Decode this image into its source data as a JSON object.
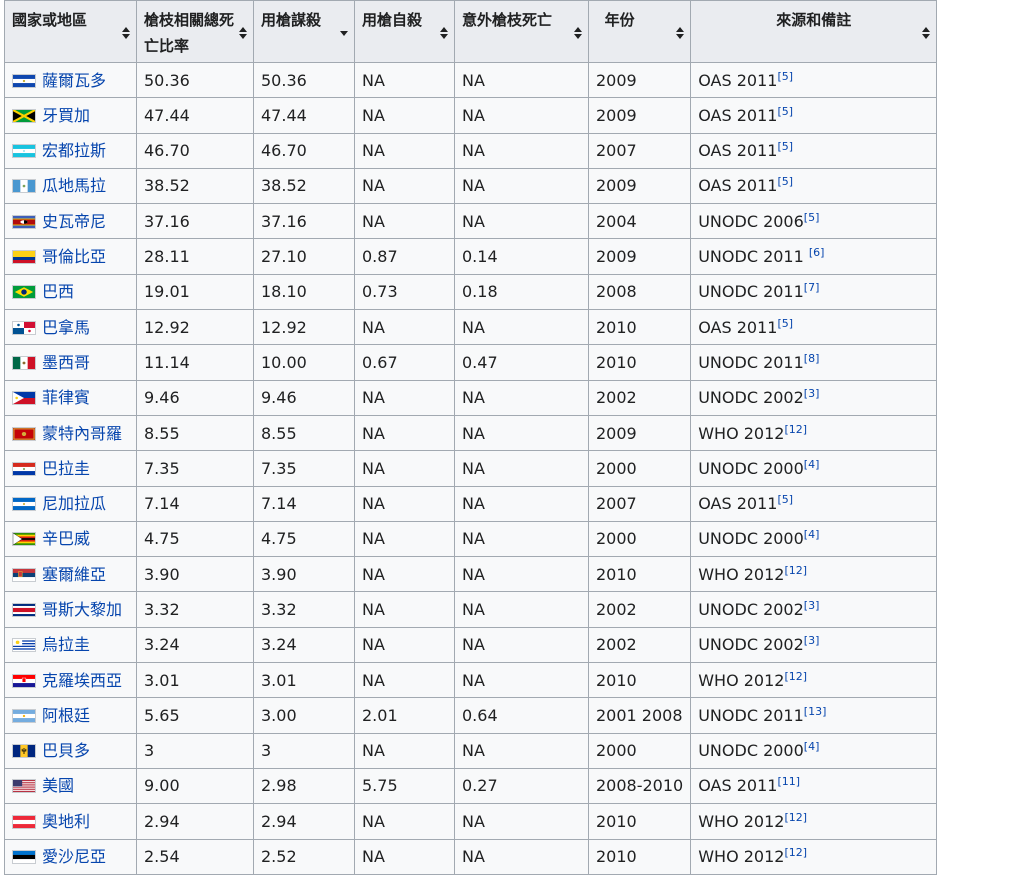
{
  "headers": [
    {
      "label": "國家或地區",
      "sort": "both"
    },
    {
      "label": "槍枝相關總死亡比率",
      "sort": "both"
    },
    {
      "label": "用槍謀殺",
      "sort": "down"
    },
    {
      "label": "用槍自殺",
      "sort": "both"
    },
    {
      "label": "意外槍枝死亡",
      "sort": "both"
    },
    {
      "label": "年份",
      "sort": "both"
    },
    {
      "label": "來源和備註",
      "sort": "both"
    }
  ],
  "rows": [
    {
      "country": "薩爾瓦多",
      "flag": "flag-el-salvador",
      "total": "50.36",
      "homicide": "50.36",
      "suicide": "NA",
      "accidental": "NA",
      "year": "2009",
      "source": "OAS 2011",
      "ref": "[5]"
    },
    {
      "country": "牙買加",
      "flag": "flag-jamaica",
      "total": "47.44",
      "homicide": "47.44",
      "suicide": "NA",
      "accidental": "NA",
      "year": "2009",
      "source": "OAS 2011",
      "ref": "[5]"
    },
    {
      "country": "宏都拉斯",
      "flag": "flag-honduras",
      "total": "46.70",
      "homicide": "46.70",
      "suicide": "NA",
      "accidental": "NA",
      "year": "2007",
      "source": "OAS 2011",
      "ref": "[5]"
    },
    {
      "country": "瓜地馬拉",
      "flag": "flag-guatemala",
      "total": "38.52",
      "homicide": "38.52",
      "suicide": "NA",
      "accidental": "NA",
      "year": "2009",
      "source": "OAS 2011",
      "ref": "[5]"
    },
    {
      "country": "史瓦帝尼",
      "flag": "flag-eswatini",
      "total": "37.16",
      "homicide": "37.16",
      "suicide": "NA",
      "accidental": "NA",
      "year": "2004",
      "source": "UNODC 2006",
      "ref": "[5]"
    },
    {
      "country": "哥倫比亞",
      "flag": "flag-colombia",
      "total": "28.11",
      "homicide": "27.10",
      "suicide": "0.87",
      "accidental": "0.14",
      "year": "2009",
      "source": "UNODC 2011 ",
      "ref": "[6]"
    },
    {
      "country": "巴西",
      "flag": "flag-brazil",
      "total": "19.01",
      "homicide": "18.10",
      "suicide": "0.73",
      "accidental": "0.18",
      "year": "2008",
      "source": "UNODC 2011",
      "ref": "[7]"
    },
    {
      "country": "巴拿馬",
      "flag": "flag-panama",
      "total": "12.92",
      "homicide": "12.92",
      "suicide": "NA",
      "accidental": "NA",
      "year": "2010",
      "source": "OAS 2011",
      "ref": "[5]"
    },
    {
      "country": "墨西哥",
      "flag": "flag-mexico",
      "total": "11.14",
      "homicide": "10.00",
      "suicide": "0.67",
      "accidental": "0.47",
      "year": "2010",
      "source": "UNODC 2011",
      "ref": "[8]"
    },
    {
      "country": "菲律賓",
      "flag": "flag-philippines",
      "total": "9.46",
      "homicide": "9.46",
      "suicide": "NA",
      "accidental": "NA",
      "year": "2002",
      "source": "UNODC 2002",
      "ref": "[3]"
    },
    {
      "country": "蒙特內哥羅",
      "flag": "flag-montenegro",
      "total": "8.55",
      "homicide": "8.55",
      "suicide": "NA",
      "accidental": "NA",
      "year": "2009",
      "source": "WHO 2012",
      "ref": "[12]"
    },
    {
      "country": "巴拉圭",
      "flag": "flag-paraguay",
      "total": "7.35",
      "homicide": "7.35",
      "suicide": "NA",
      "accidental": "NA",
      "year": "2000",
      "source": "UNODC 2000",
      "ref": "[4]"
    },
    {
      "country": "尼加拉瓜",
      "flag": "flag-nicaragua",
      "total": "7.14",
      "homicide": "7.14",
      "suicide": "NA",
      "accidental": "NA",
      "year": "2007",
      "source": "OAS 2011",
      "ref": "[5]"
    },
    {
      "country": "辛巴威",
      "flag": "flag-zimbabwe",
      "total": "4.75",
      "homicide": "4.75",
      "suicide": "NA",
      "accidental": "NA",
      "year": "2000",
      "source": "UNODC 2000",
      "ref": "[4]"
    },
    {
      "country": "塞爾維亞",
      "flag": "flag-serbia",
      "total": "3.90",
      "homicide": "3.90",
      "suicide": "NA",
      "accidental": "NA",
      "year": "2010",
      "source": "WHO 2012",
      "ref": "[12]"
    },
    {
      "country": "哥斯大黎加",
      "flag": "flag-costa-rica",
      "total": "3.32",
      "homicide": "3.32",
      "suicide": "NA",
      "accidental": "NA",
      "year": "2002",
      "source": "UNODC 2002",
      "ref": "[3]"
    },
    {
      "country": "烏拉圭",
      "flag": "flag-uruguay",
      "total": "3.24",
      "homicide": "3.24",
      "suicide": "NA",
      "accidental": "NA",
      "year": "2002",
      "source": "UNODC 2002",
      "ref": "[3]"
    },
    {
      "country": "克羅埃西亞",
      "flag": "flag-croatia",
      "total": "3.01",
      "homicide": "3.01",
      "suicide": "NA",
      "accidental": "NA",
      "year": "2010",
      "source": "WHO 2012",
      "ref": "[12]"
    },
    {
      "country": "阿根廷",
      "flag": "flag-argentina",
      "total": "5.65",
      "homicide": "3.00",
      "suicide": "2.01",
      "accidental": "0.64",
      "year": "2001 2008",
      "source": "UNODC 2011",
      "ref": "[13]"
    },
    {
      "country": "巴貝多",
      "flag": "flag-barbados",
      "total": "3",
      "homicide": "3",
      "suicide": "NA",
      "accidental": "NA",
      "year": "2000",
      "source": "UNODC 2000",
      "ref": "[4]"
    },
    {
      "country": "美國",
      "flag": "flag-united-states",
      "total": "9.00",
      "homicide": "2.98",
      "suicide": "5.75",
      "accidental": "0.27",
      "year": "2008-2010",
      "source": "OAS 2011",
      "ref": "[11]"
    },
    {
      "country": "奧地利",
      "flag": "flag-austria",
      "total": "2.94",
      "homicide": "2.94",
      "suicide": "NA",
      "accidental": "NA",
      "year": "2010",
      "source": "WHO 2012",
      "ref": "[12]"
    },
    {
      "country": "愛沙尼亞",
      "flag": "flag-estonia",
      "total": "2.54",
      "homicide": "2.52",
      "suicide": "NA",
      "accidental": "NA",
      "year": "2010",
      "source": "WHO 2012",
      "ref": "[12]"
    }
  ]
}
